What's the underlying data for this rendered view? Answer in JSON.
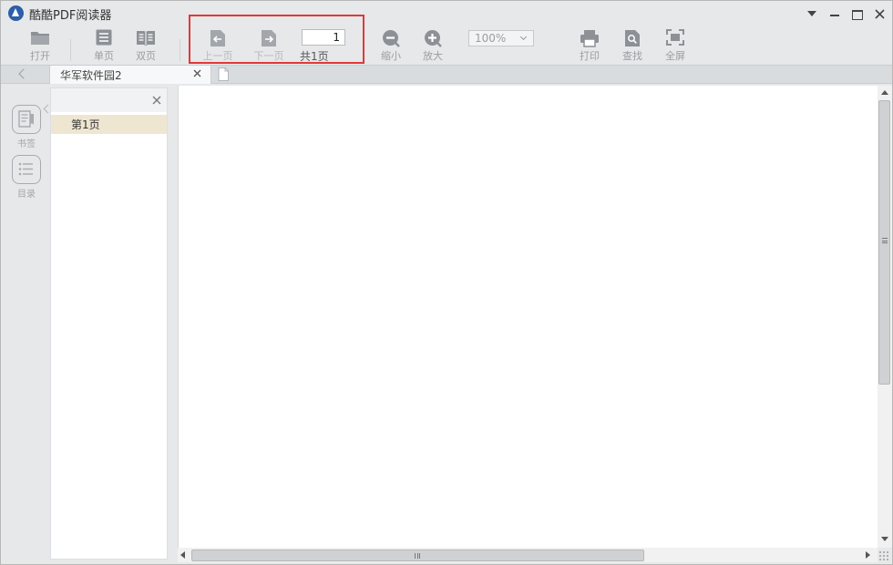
{
  "app": {
    "title": "酷酷PDF阅读器",
    "accent": "#2d5fa8",
    "highlight_color": "#e0393b"
  },
  "window_controls": [
    "menu-dropdown-icon",
    "minimize-icon",
    "maximize-icon",
    "close-icon"
  ],
  "toolbar": {
    "open": "打开",
    "single_page": "单页",
    "double_page": "双页",
    "prev_page": "上一页",
    "next_page": "下一页",
    "page_input": "1",
    "page_total": "共1页",
    "zoom_out": "缩小",
    "zoom_in": "放大",
    "zoom_value": "100%",
    "print": "打印",
    "find": "查找",
    "fullscreen": "全屏"
  },
  "tabs": [
    {
      "label": "华军软件园2",
      "active": true
    }
  ],
  "rail": {
    "bookmarks": "书签",
    "toc": "目录"
  },
  "bookmark_panel": {
    "items": [
      "第1页"
    ],
    "selected_index": 0,
    "selected_color": "#efe6d2"
  }
}
